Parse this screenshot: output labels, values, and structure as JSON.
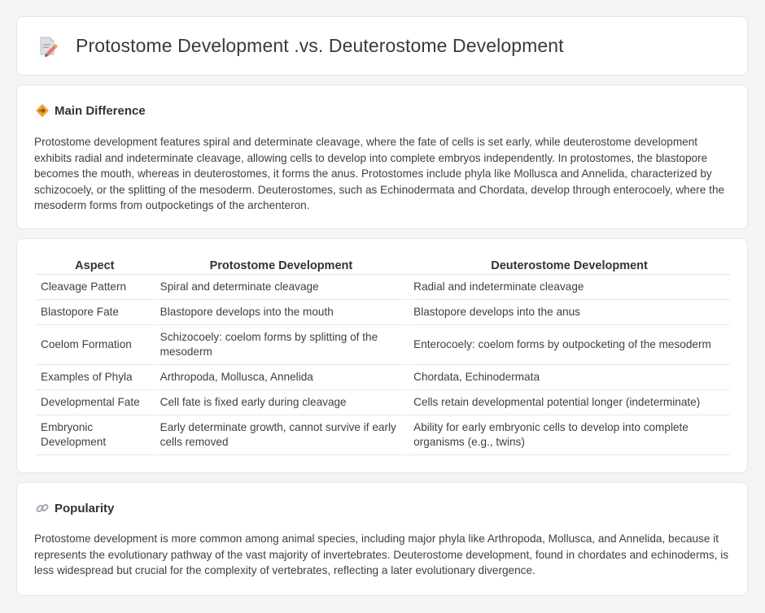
{
  "header": {
    "title": "Protostome Development .vs. Deuterostome Development",
    "icon": "document-pencil-icon"
  },
  "main_difference": {
    "heading": "Main Difference",
    "icon": "diamond-arrows-icon",
    "text": "Protostome development features spiral and determinate cleavage, where the fate of cells is set early, while deuterostome development exhibits radial and indeterminate cleavage, allowing cells to develop into complete embryos independently. In protostomes, the blastopore becomes the mouth, whereas in deuterostomes, it forms the anus. Protostomes include phyla like Mollusca and Annelida, characterized by schizocoely, or the splitting of the mesoderm. Deuterostomes, such as Echinodermata and Chordata, develop through enterocoely, where the mesoderm forms from outpocketings of the archenteron."
  },
  "table": {
    "headers": [
      "Aspect",
      "Protostome Development",
      "Deuterostome Development"
    ],
    "rows": [
      [
        "Cleavage Pattern",
        "Spiral and determinate cleavage",
        "Radial and indeterminate cleavage"
      ],
      [
        "Blastopore Fate",
        "Blastopore develops into the mouth",
        "Blastopore develops into the anus"
      ],
      [
        "Coelom Formation",
        "Schizocoely: coelom forms by splitting of the mesoderm",
        "Enterocoely: coelom forms by outpocketing of the mesoderm"
      ],
      [
        "Examples of Phyla",
        "Arthropoda, Mollusca, Annelida",
        "Chordata, Echinodermata"
      ],
      [
        "Developmental Fate",
        "Cell fate is fixed early during cleavage",
        "Cells retain developmental potential longer (indeterminate)"
      ],
      [
        "Embryonic Development",
        "Early determinate growth, cannot survive if early cells removed",
        "Ability for early embryonic cells to develop into complete organisms (e.g., twins)"
      ]
    ]
  },
  "popularity": {
    "heading": "Popularity",
    "icon": "link-icon",
    "text": "Protostome development is more common among animal species, including major phyla like Arthropoda, Mollusca, and Annelida, because it represents the evolutionary pathway of the vast majority of invertebrates. Deuterostome development, found in chordates and echinoderms, is less widespread but crucial for the complexity of vertebrates, reflecting a later evolutionary divergence."
  },
  "colors": {
    "background": "#f3f4f6",
    "card": "#ffffff",
    "accent_orange": "#f0a030",
    "icon_pink": "#e8737b"
  }
}
